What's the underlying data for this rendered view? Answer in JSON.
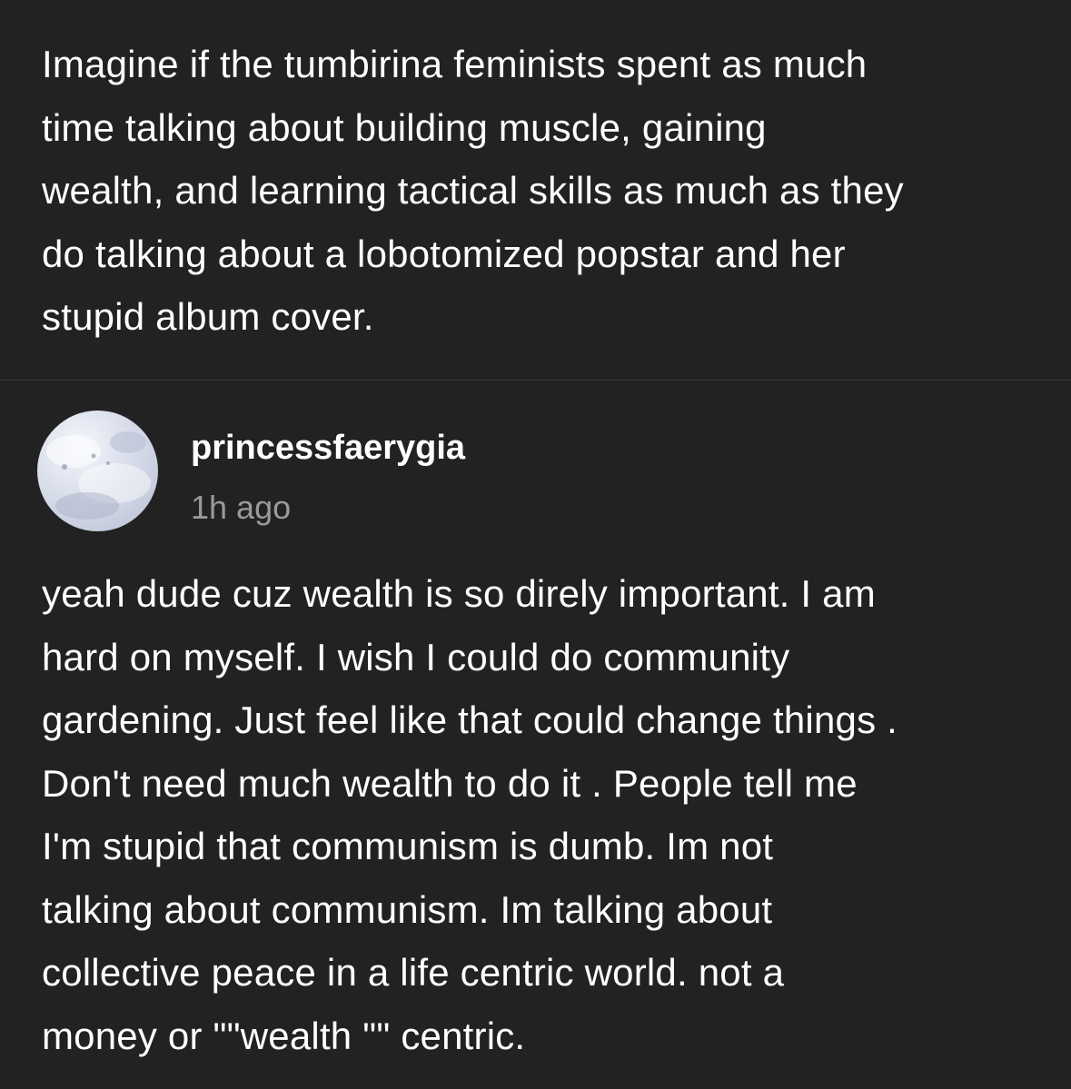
{
  "post": {
    "body": "Imagine if the tumbirina feminists spent as much\ntime talking about building muscle, gaining\nwealth, and learning tactical skills as much as they\ndo talking about a lobotomized popstar and her\nstupid album cover."
  },
  "reply": {
    "avatar_icon": "avatar-image",
    "username": "princessfaerygia",
    "timestamp": "1h ago",
    "body": "yeah dude cuz wealth is so direly important. I am\nhard on myself. I wish I could do community\ngardening. Just feel like that could change things .\nDon't need much wealth to do it . People tell me\nI'm stupid that communism is dumb. Im not\ntalking about communism. Im talking about\ncollective peace in a life centric world. not a\nmoney or \"\"wealth \"\" centric."
  },
  "colors": {
    "background": "#222222",
    "text": "#ffffff",
    "muted_text": "#9a9a9a",
    "divider": "#3c3c3c"
  }
}
